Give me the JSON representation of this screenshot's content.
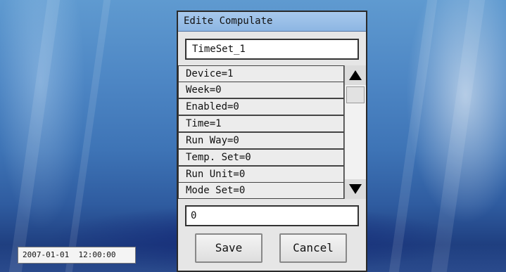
{
  "clock": {
    "text": "2007-01-01  12:00:00"
  },
  "dialog": {
    "title": "Edite Compulate",
    "name_value": "TimeSet_1",
    "items": [
      {
        "label": "Device=1"
      },
      {
        "label": "Week=0"
      },
      {
        "label": "Enabled=0"
      },
      {
        "label": "Time=1"
      },
      {
        "label": "Run Way=0"
      },
      {
        "label": "Temp. Set=0"
      },
      {
        "label": "Run Unit=0"
      },
      {
        "label": "Mode Set=0"
      }
    ],
    "value_field": "0",
    "save_label": "Save",
    "cancel_label": "Cancel"
  },
  "icons": {
    "scroll_up": "triangle-up-icon",
    "scroll_down": "triangle-down-icon"
  },
  "colors": {
    "titlebar": "#8db6e3",
    "desktop": "#3e74b6"
  }
}
